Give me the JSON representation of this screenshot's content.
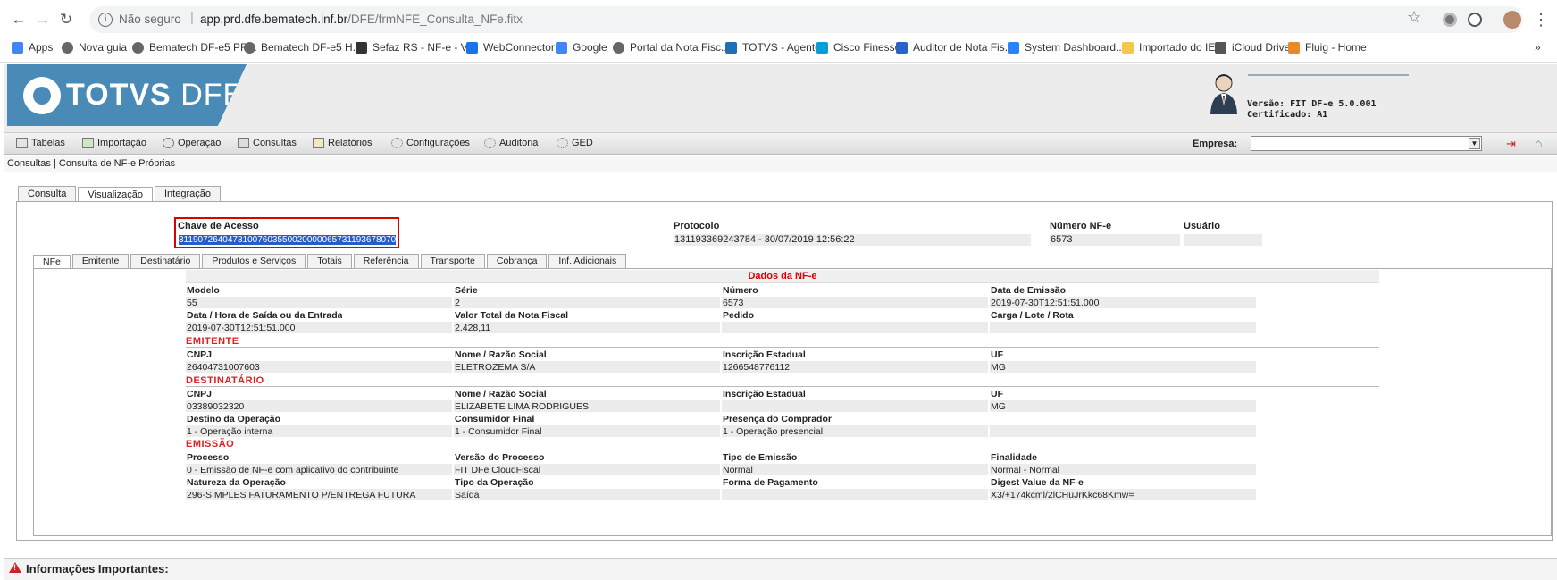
{
  "browser": {
    "security_label": "Não seguro",
    "url_host": "app.prd.dfe.bematech.inf.br",
    "url_path": "/DFE/frmNFE_Consulta_NFe.fitx",
    "bookmarks": [
      {
        "label": "Apps",
        "icon": "apps-grid-icon",
        "color": "#4285f4"
      },
      {
        "label": "Nova guia",
        "icon": "globe-icon",
        "color": "#666"
      },
      {
        "label": "Bematech DF-e5 PR...",
        "icon": "globe-icon",
        "color": "#666"
      },
      {
        "label": "Bematech DF-e5 H...",
        "icon": "globe-icon",
        "color": "#666"
      },
      {
        "label": "Sefaz RS - NF-e - V...",
        "icon": "sefaz-icon",
        "color": "#333"
      },
      {
        "label": "WebConnector",
        "icon": "webconnector-icon",
        "color": "#1a73e8"
      },
      {
        "label": "Google",
        "icon": "google-icon",
        "color": "#4285f4"
      },
      {
        "label": "Portal da Nota Fisc...",
        "icon": "globe-icon",
        "color": "#666"
      },
      {
        "label": "TOTVS - Agente",
        "icon": "totvs-icon",
        "color": "#1f6fb5"
      },
      {
        "label": "Cisco Finesse",
        "icon": "cisco-icon",
        "color": "#049fd9"
      },
      {
        "label": "Auditor de Nota Fis...",
        "icon": "auditor-icon",
        "color": "#2a62c9"
      },
      {
        "label": "System Dashboard...",
        "icon": "jira-icon",
        "color": "#2684ff"
      },
      {
        "label": "Importado do IE",
        "icon": "folder-icon",
        "color": "#f2c94c"
      },
      {
        "label": "iCloud Drive",
        "icon": "apple-icon",
        "color": "#555"
      },
      {
        "label": "Fluig - Home",
        "icon": "fluig-icon",
        "color": "#e8892b"
      }
    ],
    "more_bookmarks": "»"
  },
  "header": {
    "logo_bold": "TOTVS",
    "logo_light": "DFE",
    "version": "Versão: FIT DF-e 5.0.001",
    "certificate": "Certificado: A1"
  },
  "menu": {
    "items": [
      "Tabelas",
      "Importação",
      "Operação",
      "Consultas",
      "Relatórios",
      "Configurações",
      "Auditoria",
      "GED"
    ],
    "empresa_label": "Empresa:",
    "empresa_value": ""
  },
  "breadcrumb": "Consultas | Consulta de NF-e Próprias",
  "tabs": [
    "Consulta",
    "Visualização",
    "Integração"
  ],
  "nfe_header": {
    "chave_label": "Chave de Acesso",
    "chave_value": "31190726404731007603550020000065731193678070",
    "protocolo_label": "Protocolo",
    "protocolo_value": "131193369243784 - 30/07/2019 12:56:22",
    "numero_label": "Número NF-e",
    "numero_value": "6573",
    "usuario_label": "Usuário",
    "usuario_value": ""
  },
  "subtabs": [
    "NFe",
    "Emitente",
    "Destinatário",
    "Produtos e Serviços",
    "Totais",
    "Referência",
    "Transporte",
    "Cobrança",
    "Inf. Adicionais"
  ],
  "dados": {
    "title": "Dados da NF-e",
    "rows": [
      {
        "labels": [
          "Modelo",
          "Série",
          "Número",
          "Data de Emissão"
        ],
        "values": [
          "55",
          "2",
          "6573",
          "2019-07-30T12:51:51.000"
        ]
      },
      {
        "labels": [
          "Data / Hora de Saída ou da Entrada",
          "Valor Total da Nota Fiscal",
          "Pedido",
          "Carga / Lote / Rota"
        ],
        "values": [
          "2019-07-30T12:51:51.000",
          "2.428,11",
          "",
          ""
        ]
      }
    ]
  },
  "emitente": {
    "title": "EMITENTE",
    "labels": [
      "CNPJ",
      "Nome / Razão Social",
      "Inscrição Estadual",
      "UF"
    ],
    "values": [
      "26404731007603",
      "ELETROZEMA S/A",
      "1266548776112",
      "MG"
    ]
  },
  "destinatario": {
    "title": "DESTINATÁRIO",
    "rows": [
      {
        "labels": [
          "CNPJ",
          "Nome / Razão Social",
          "Inscrição Estadual",
          "UF"
        ],
        "values": [
          "03389032320",
          "ELIZABETE LIMA RODRIGUES",
          "",
          "MG"
        ]
      },
      {
        "labels": [
          "Destino da Operação",
          "Consumidor Final",
          "Presença do Comprador",
          ""
        ],
        "values": [
          "1 - Operação interna",
          "1 - Consumidor Final",
          "1 - Operação presencial",
          ""
        ]
      }
    ]
  },
  "emissao": {
    "title": "EMISSÃO",
    "rows": [
      {
        "labels": [
          "Processo",
          "Versão do Processo",
          "Tipo de Emissão",
          "Finalidade"
        ],
        "values": [
          "0 - Emissão de NF-e com aplicativo do contribuinte",
          "FIT DFe CloudFiscal",
          "Normal",
          "Normal - Normal"
        ]
      },
      {
        "labels": [
          "Natureza da Operação",
          "Tipo da Operação",
          "Forma de Pagamento",
          "Digest Value da NF-e"
        ],
        "values": [
          "296-SIMPLES FATURAMENTO P/ENTREGA FUTURA",
          "Saída",
          "",
          "X3/+174kcml/2lCHuJrKkc68Kmw="
        ]
      }
    ]
  },
  "footer": "Informações Importantes:",
  "colors": {
    "brand": "#4a8ab6",
    "section_red": "#d22",
    "selection": "#2a5cc9"
  }
}
